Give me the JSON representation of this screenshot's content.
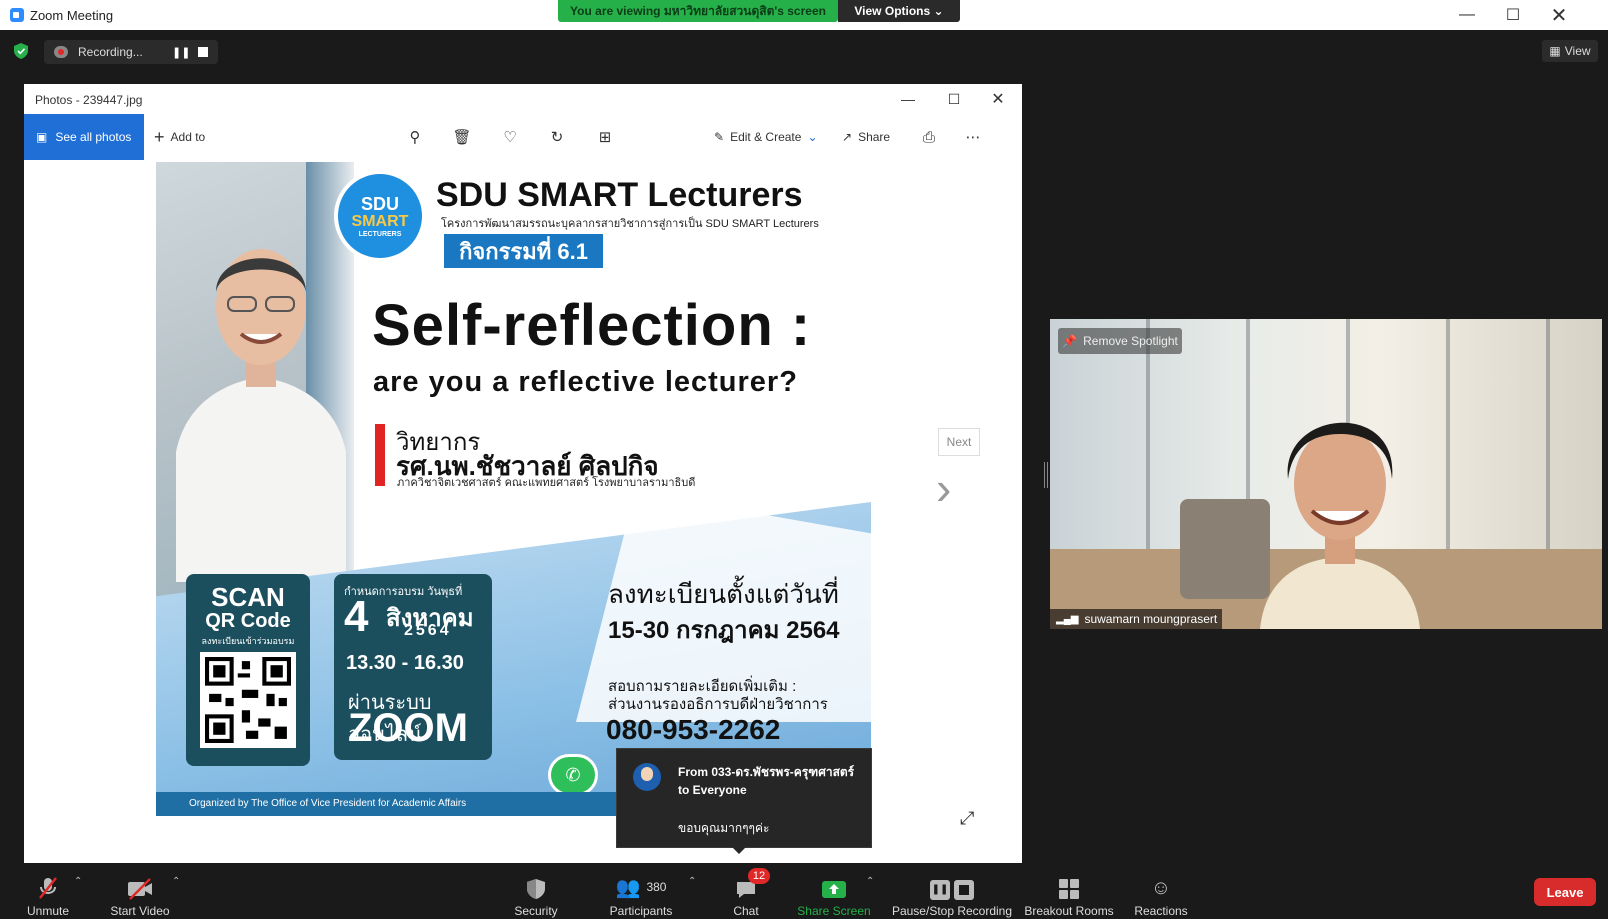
{
  "window": {
    "title": "Zoom Meeting"
  },
  "share_banner": {
    "text": "You are viewing มหาวิทยาลัยสวนดุสิต's screen",
    "view_options": "View Options"
  },
  "recording": {
    "label": "Recording..."
  },
  "view_button": {
    "label": "View"
  },
  "photos": {
    "title": "Photos - 239447.jpg",
    "toolbar": {
      "see_all": "See all photos",
      "add_to": "Add to",
      "edit_create": "Edit & Create",
      "share": "Share"
    },
    "next": "Next"
  },
  "poster": {
    "badge_line1": "SDU",
    "badge_line2": "SMART",
    "badge_line3": "LECTURERS",
    "brand": "SDU SMART Lecturers",
    "brand_sub": "โครงการพัฒนาสมรรถนะบุคลากรสายวิชาการสู่การเป็น SDU SMART Lecturers",
    "activity": "กิจกรรมที่ 6.1",
    "headline": "Self-reflection :",
    "subheadline": "are you a reflective lecturer?",
    "speaker_label": "วิทยากร",
    "speaker_name": "รศ.นพ.ชัชวาลย์ ศิลปกิจ",
    "speaker_affil": "ภาควิชาจิตเวชศาสตร์ คณะแพทยศาสตร์ โรงพยาบาลรามาธิบดี",
    "scan1": "SCAN",
    "scan2": "QR Code",
    "scan3": "ลงทะเบียนเข้าร่วมอบรม",
    "date_label": "กำหนดการอบรม วันพุธที่",
    "date_day": "4",
    "date_month": "สิงหาคม",
    "date_year": "2564",
    "date_time": "13.30 - 16.30",
    "date_via": "ผ่านระบบออนไลน์",
    "date_platform": "ZOOM",
    "reg_label": "ลงทะเบียนตั้งแต่วันที่",
    "reg_dates": "15-30 กรกฎาคม 2564",
    "info1": "สอบถามรายละเอียดเพิ่มเติม :",
    "info2": "ส่วนงานรองอธิการบดีฝ่ายวิชาการ",
    "phone": "080-953-2262",
    "footer": "Organized by  The Office of Vice President for Academic Affairs"
  },
  "chat_popup": {
    "from": "From 033-ดร.พัชรพร-ครุฑศาสตร์ to Everyone",
    "message": "ขอบคุณมากๆๆค่ะ"
  },
  "video": {
    "remove_spotlight": "Remove Spotlight",
    "participant": "suwamarn moungprasert"
  },
  "bottom": {
    "unmute": "Unmute",
    "start_video": "Start Video",
    "security": "Security",
    "participants": "Participants",
    "participants_count": "380",
    "chat": "Chat",
    "chat_badge": "12",
    "share_screen": "Share Screen",
    "pause_stop": "Pause/Stop Recording",
    "breakout": "Breakout Rooms",
    "reactions": "Reactions",
    "leave": "Leave"
  }
}
